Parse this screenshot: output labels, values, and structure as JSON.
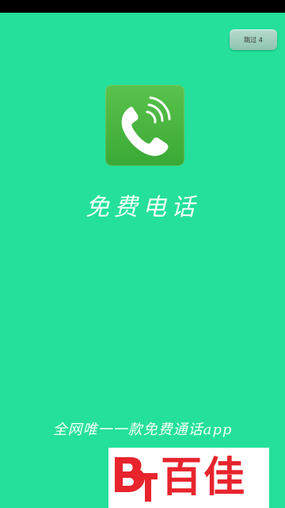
{
  "status_bar": {},
  "skip_button": {
    "label": "跳过 4"
  },
  "app": {
    "logo_icon": "phone-handset-icon",
    "title": "免费电话",
    "slogan": "全网唯一一款免费通话app"
  },
  "brand": {
    "name": "百佳"
  },
  "colors": {
    "background": "#24e09a",
    "logo_green": "#43b33c",
    "brand_red": "#e8242d"
  }
}
